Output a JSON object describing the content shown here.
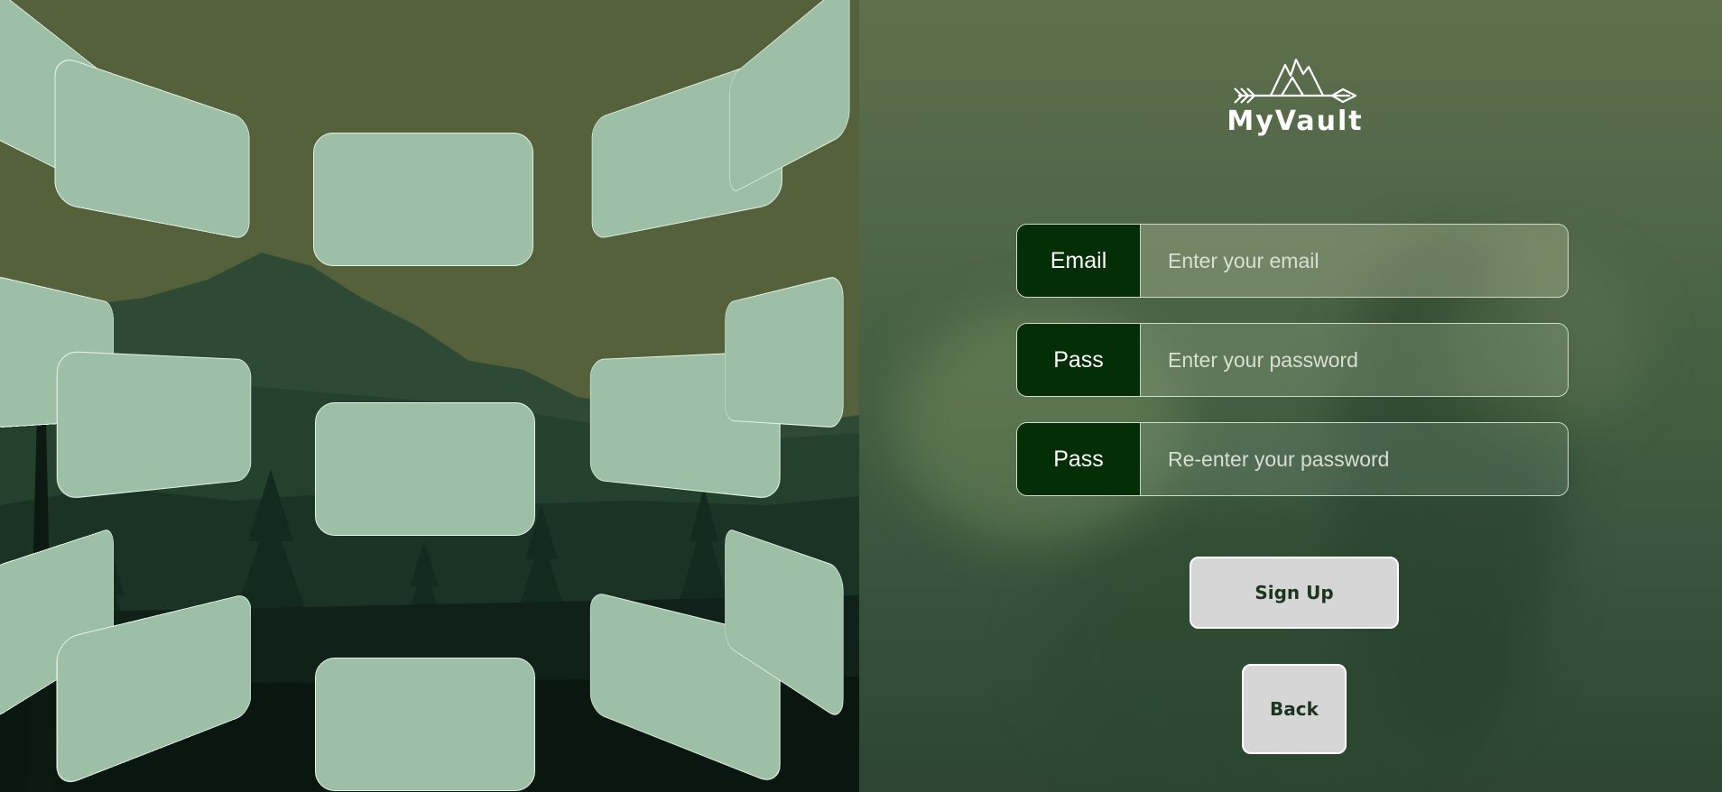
{
  "brand": {
    "name": "MyVault",
    "logo_icon": "mountain-arrow-logo-icon"
  },
  "form": {
    "email": {
      "label": "Email",
      "placeholder": "Enter your email"
    },
    "password": {
      "label": "Pass",
      "placeholder": "Enter your password"
    },
    "confirm": {
      "label": "Pass",
      "placeholder": "Re-enter your password"
    }
  },
  "buttons": {
    "signup": "Sign Up",
    "back": "Back"
  },
  "colors": {
    "accent": "#032e06",
    "card": "#9dbfa5",
    "button": "#d6d6d6",
    "sky": "#55613b"
  }
}
